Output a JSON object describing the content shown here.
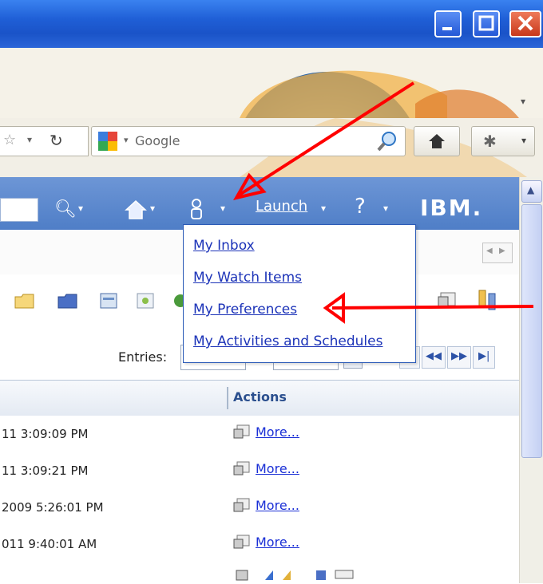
{
  "search": {
    "engine_label": "Google"
  },
  "header": {
    "launch_label": "Launch",
    "brand": "IBM."
  },
  "dropdown": {
    "items": [
      {
        "label": "My Inbox"
      },
      {
        "label": "My Watch Items"
      },
      {
        "label": "My Preferences"
      },
      {
        "label": "My Activities and Schedules"
      }
    ]
  },
  "pager": {
    "entries_label": "Entries:"
  },
  "grid": {
    "actions_header": "Actions",
    "rows": [
      {
        "time": "11 3:09:09 PM",
        "action": "More..."
      },
      {
        "time": "11 3:09:21 PM",
        "action": "More..."
      },
      {
        "time": "2009 5:26:01 PM",
        "action": "More..."
      },
      {
        "time": "011 9:40:01 AM",
        "action": "More..."
      }
    ]
  },
  "colors": {
    "annotation_arrow": "#ff0000",
    "header_blue": "#5a87cc",
    "link_blue": "#1c33b8"
  }
}
